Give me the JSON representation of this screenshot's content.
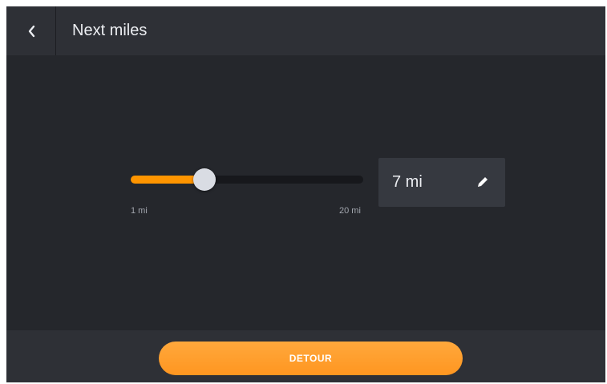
{
  "header": {
    "title": "Next miles",
    "back_icon": "chevron-left-icon"
  },
  "slider": {
    "min_label": "1 mi",
    "max_label": "20 mi",
    "min": 1,
    "max": 20,
    "value": 7
  },
  "value_box": {
    "value_text": "7 mi",
    "edit_icon": "pencil-icon"
  },
  "footer": {
    "detour_label": "DETOUR"
  },
  "colors": {
    "accent": "#ff9500",
    "background": "#25272c",
    "header_bg": "#2e3036",
    "text": "#eceef2"
  }
}
